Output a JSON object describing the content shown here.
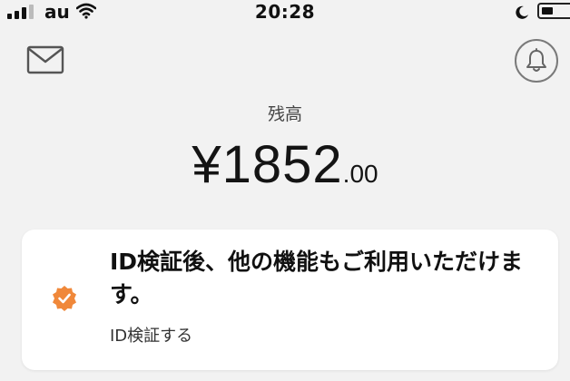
{
  "status_bar": {
    "carrier": "au",
    "time": "20:28"
  },
  "balance": {
    "label": "残高",
    "amount": "¥1852",
    "decimal": ".00"
  },
  "id_card": {
    "message": "ID検証後、他の機能もご利用いただけます。",
    "link": "ID検証する"
  },
  "colors": {
    "background": "#f2f2f2",
    "card": "#ffffff",
    "badge_orange": "#f0883a"
  },
  "icons": {
    "mail": "mail-icon",
    "bell": "bell-icon",
    "badge": "verified-badge-icon"
  }
}
